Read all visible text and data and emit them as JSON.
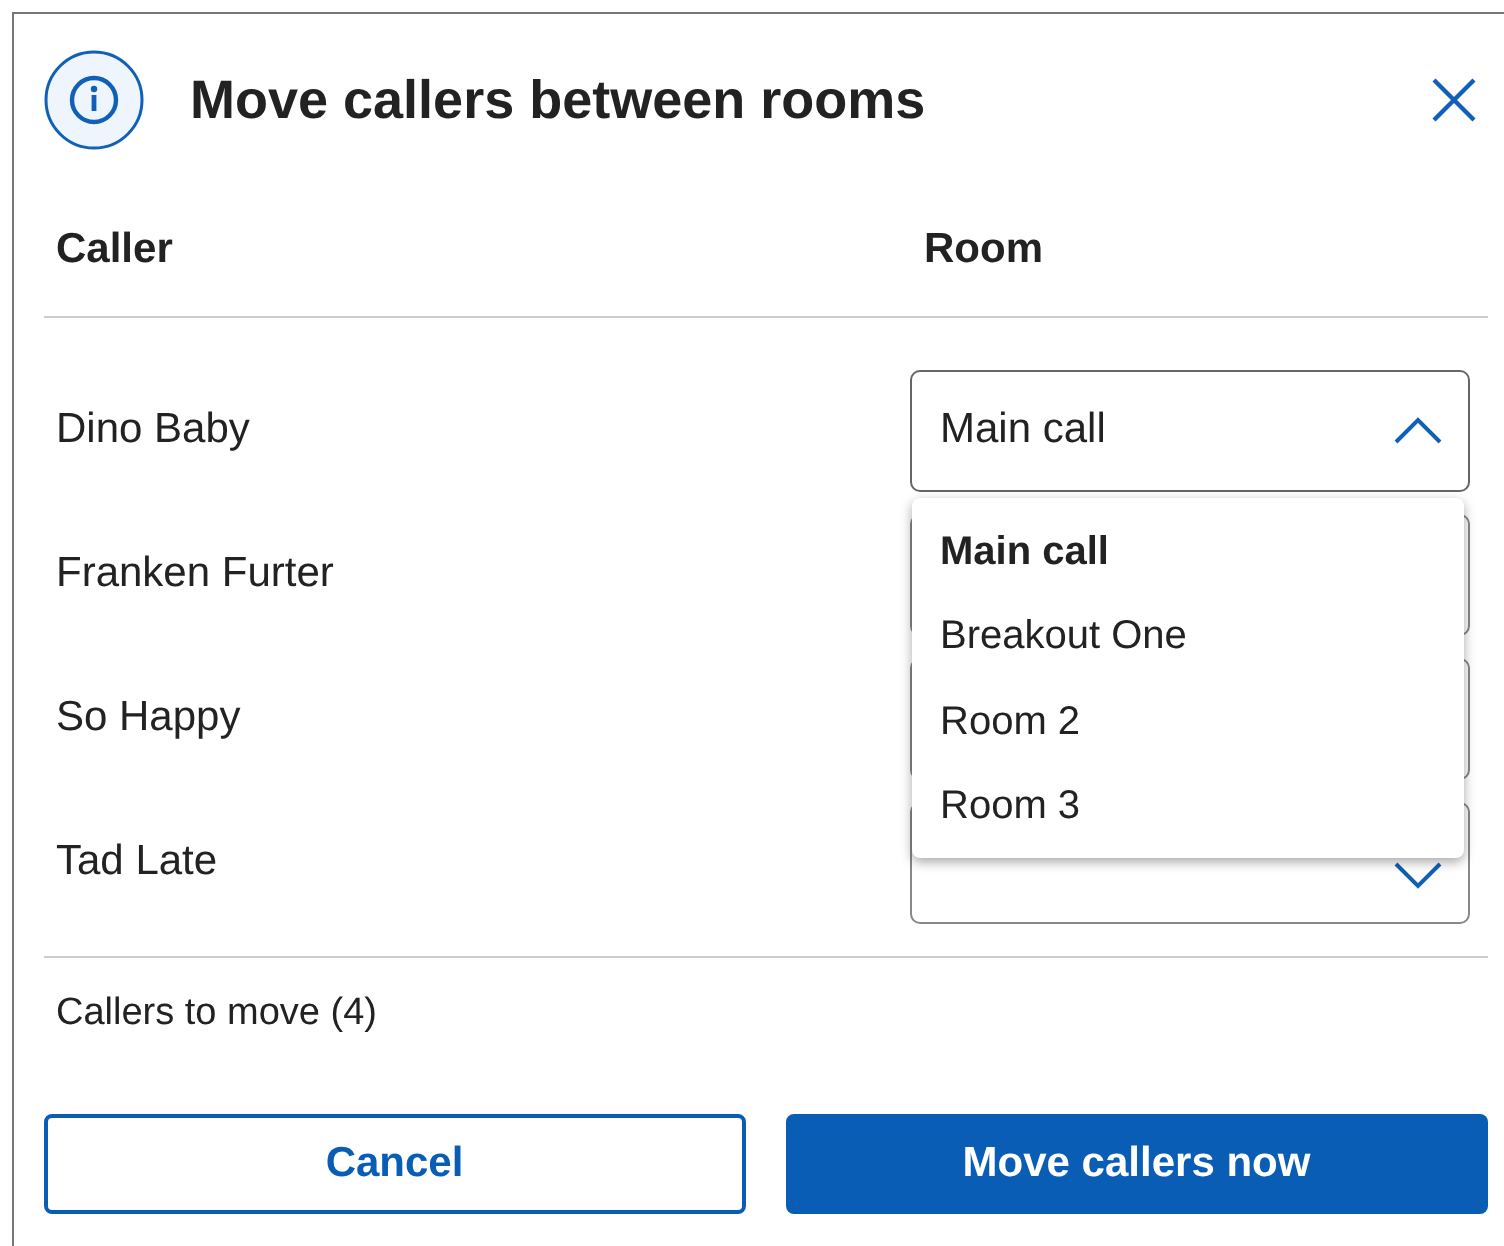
{
  "dialog": {
    "title": "Move callers between rooms",
    "columns": [
      "Caller",
      "Room"
    ]
  },
  "rows": [
    {
      "caller": "Dino Baby",
      "room": "Main call",
      "expanded": true
    },
    {
      "caller": "Franken Furter"
    },
    {
      "caller": "So Happy"
    },
    {
      "caller": "Tad Late",
      "expanded": false
    }
  ],
  "dropdown": {
    "options": [
      {
        "label": "Main call",
        "selected": true
      },
      {
        "label": "Breakout One",
        "selected": false
      },
      {
        "label": "Room 2",
        "selected": false
      },
      {
        "label": "Room 3",
        "selected": false
      }
    ]
  },
  "summary": "Callers to move (4)",
  "buttons": {
    "cancel": "Cancel",
    "confirm": "Move callers now"
  }
}
